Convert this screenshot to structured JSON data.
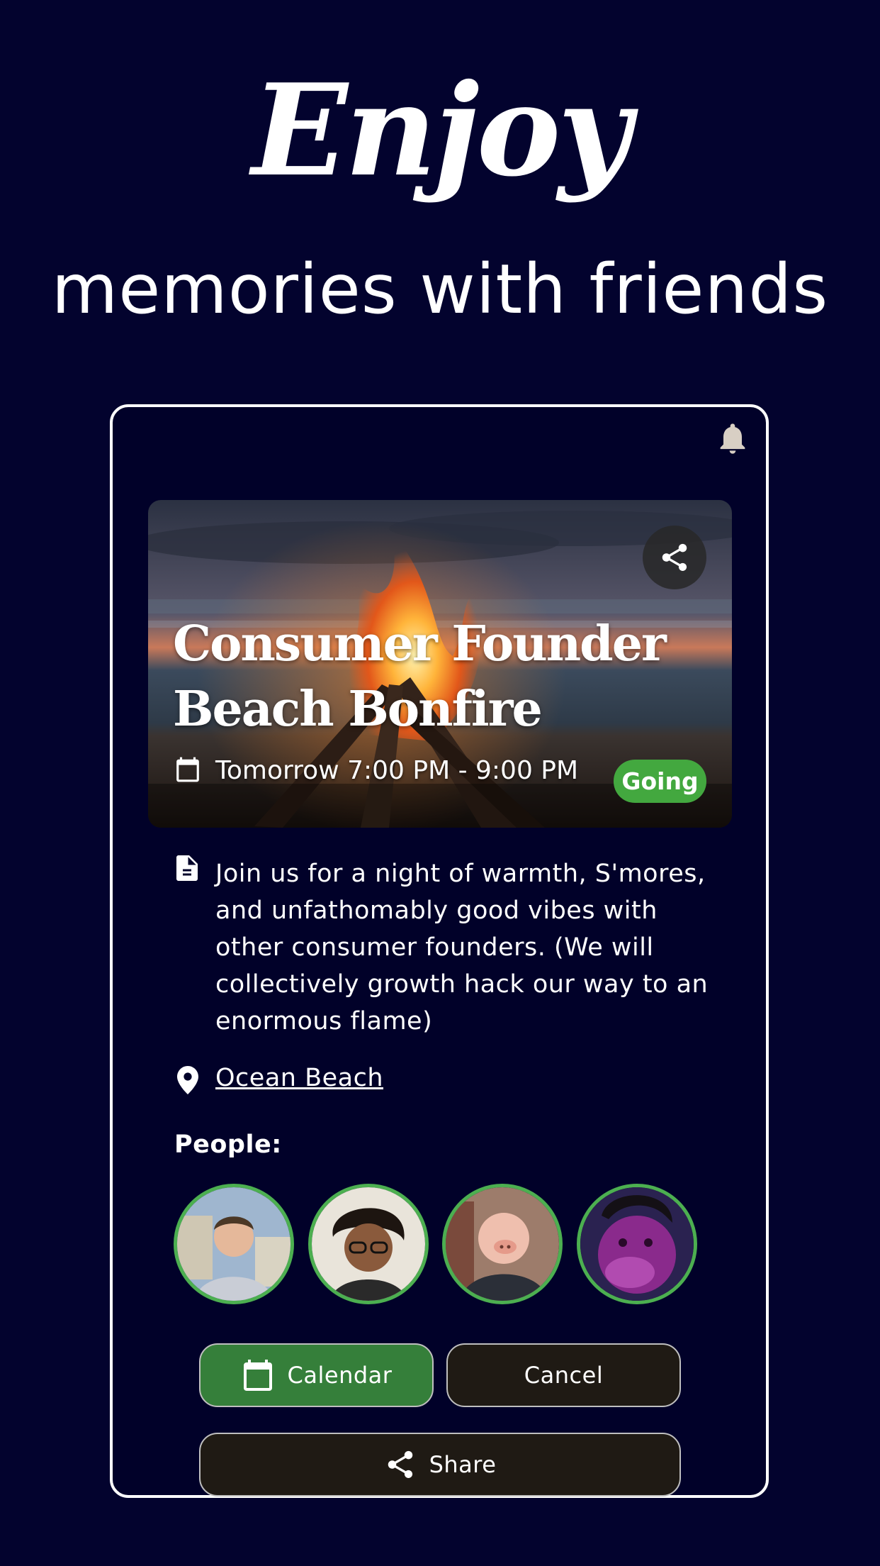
{
  "hero": {
    "headline": "Enjoy",
    "subheadline": "memories with friends"
  },
  "event": {
    "title_line1": "Consumer Founder",
    "title_line2": "Beach Bonfire",
    "datetime": "Tomorrow 7:00 PM - 9:00 PM",
    "status_badge": "Going",
    "description": "Join us for a night of warmth, S'mores, and unfathomably good vibes with other consumer founders. (We will collectively growth hack our way to an enormous flame)",
    "location": "Ocean Beach",
    "people_label": "People:"
  },
  "actions": {
    "calendar_label": "Calendar",
    "cancel_label": "Cancel",
    "share_label": "Share"
  },
  "colors": {
    "background": "#03032e",
    "going_green": "#43a83f",
    "calendar_button": "#357f3a",
    "dark_button": "#1f1a14",
    "avatar_ring": "#4caf50"
  },
  "icons": [
    "bell-icon",
    "share-icon",
    "calendar-icon",
    "document-icon",
    "location-pin-icon"
  ]
}
